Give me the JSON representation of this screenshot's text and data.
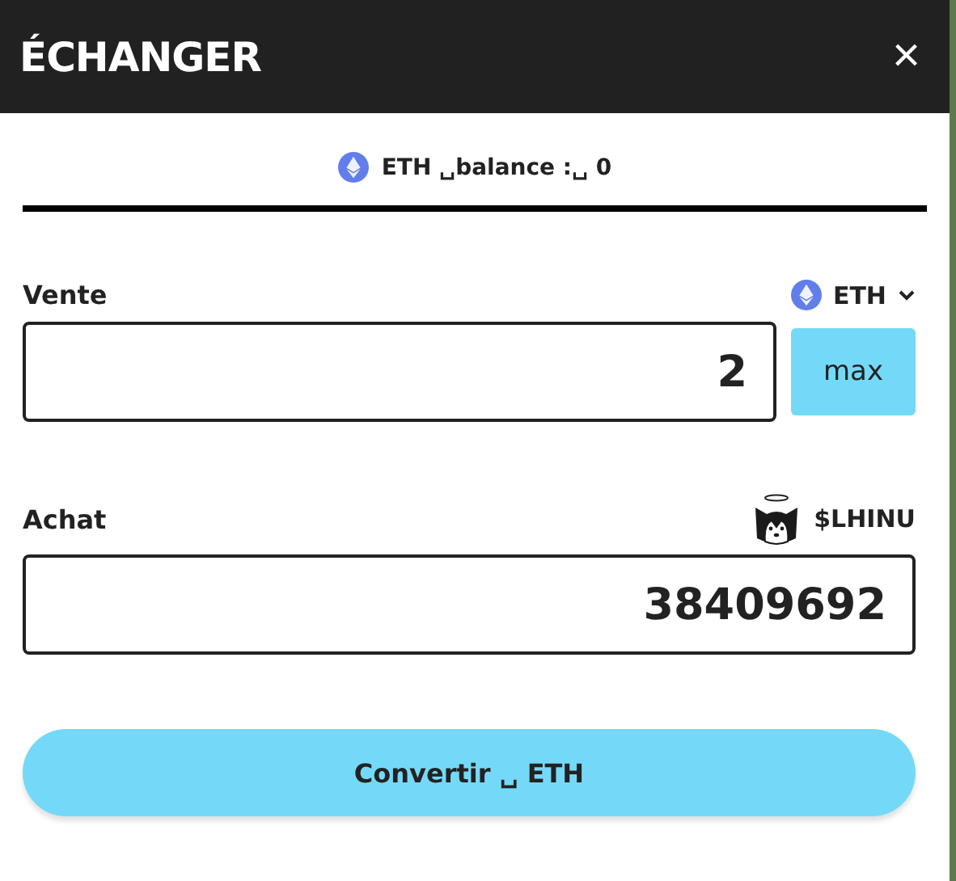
{
  "header": {
    "title": "ÉCHANGER",
    "close": "×"
  },
  "balance": {
    "text": "ETH ␣balance :␣ 0"
  },
  "sell": {
    "label": "Vente",
    "token": "ETH",
    "value": "2",
    "max_button": "max"
  },
  "buy": {
    "label": "Achat",
    "token": "$LHINU",
    "value": "38409692"
  },
  "convert_button": "Convertir ␣ ETH"
}
